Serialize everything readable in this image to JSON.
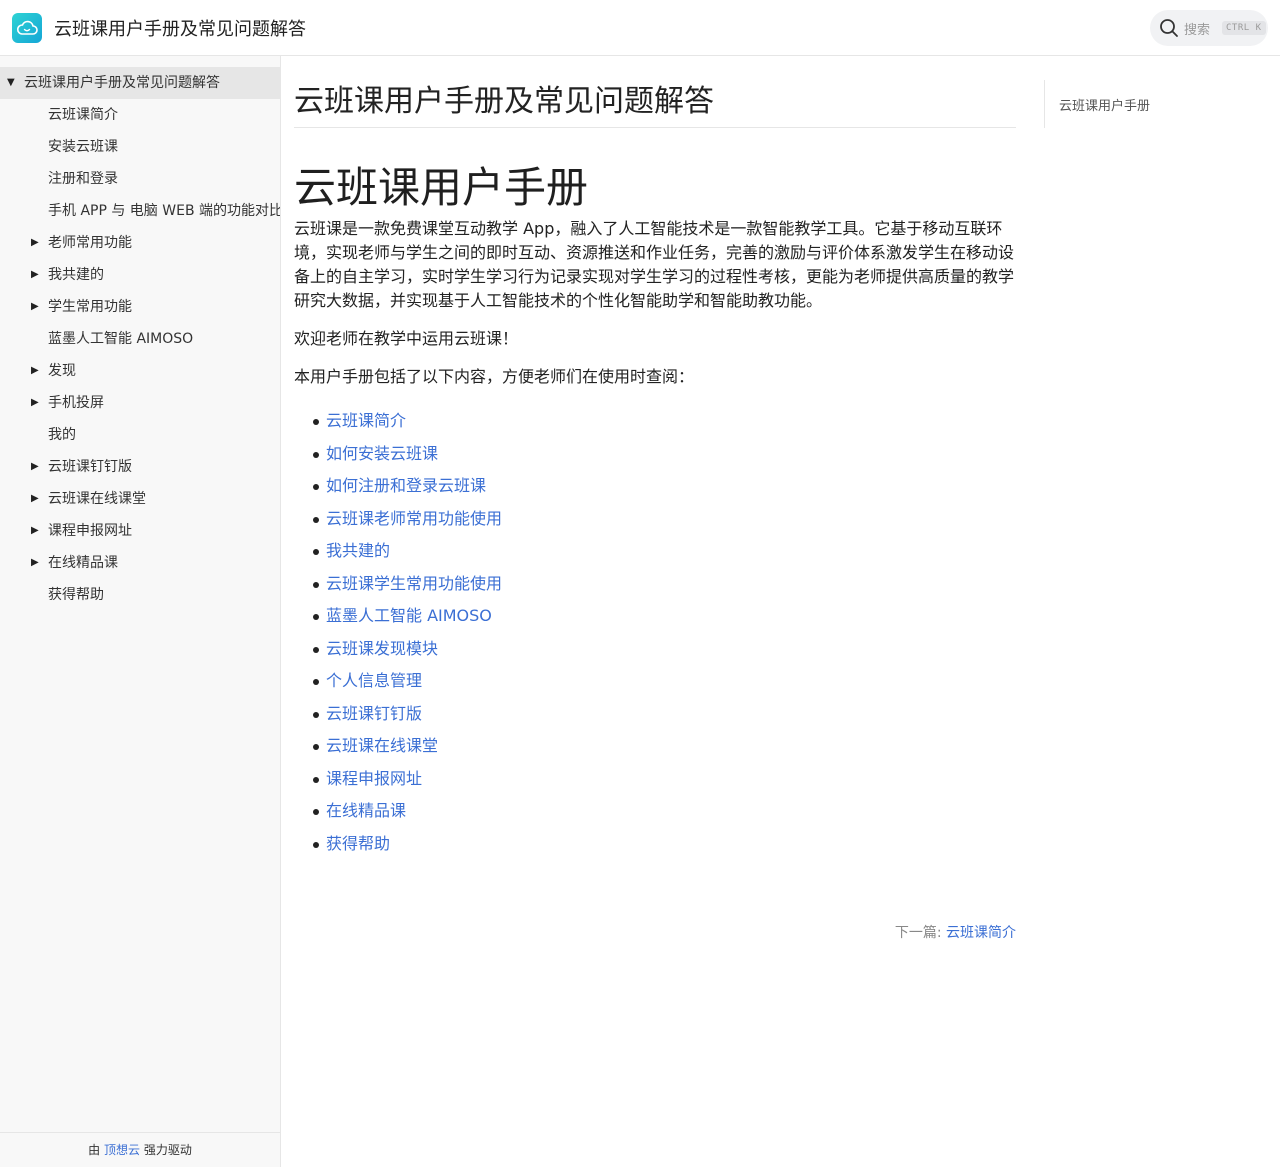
{
  "header": {
    "logo_icon": "cloud-icon",
    "title": "云班课用户手册及常见问题解答",
    "search": {
      "placeholder": "搜索",
      "shortcut": "CTRL K",
      "icon": "search-icon"
    }
  },
  "sidebar": {
    "items": [
      {
        "label": "云班课用户手册及常见问题解答",
        "expandable": true,
        "expanded": true,
        "active": true
      },
      {
        "label": "云班课简介",
        "expandable": false
      },
      {
        "label": "安装云班课",
        "expandable": false
      },
      {
        "label": "注册和登录",
        "expandable": false
      },
      {
        "label": "手机 APP 与 电脑 WEB 端的功能对比",
        "expandable": false
      },
      {
        "label": "老师常用功能",
        "expandable": true
      },
      {
        "label": "我共建的",
        "expandable": true
      },
      {
        "label": "学生常用功能",
        "expandable": true
      },
      {
        "label": "蓝墨人工智能 AIMOSO",
        "expandable": false
      },
      {
        "label": "发现",
        "expandable": true
      },
      {
        "label": "手机投屏",
        "expandable": true
      },
      {
        "label": "我的",
        "expandable": false
      },
      {
        "label": "云班课钉钉版",
        "expandable": true
      },
      {
        "label": "云班课在线课堂",
        "expandable": true
      },
      {
        "label": "课程申报网址",
        "expandable": true
      },
      {
        "label": "在线精品课",
        "expandable": true
      },
      {
        "label": "获得帮助",
        "expandable": false
      }
    ],
    "footer": {
      "prefix": "由",
      "brand": "顶想云",
      "suffix": "强力驱动"
    }
  },
  "main": {
    "page_heading": "云班课用户手册及常见问题解答",
    "h1": "云班课用户手册",
    "paragraphs": [
      "云班课是一款免费课堂互动教学 App，融入了人工智能技术是一款智能教学工具。它基于移动互联环境，实现老师与学生之间的即时互动、资源推送和作业任务，完善的激励与评价体系激发学生在移动设备上的自主学习，实时学生学习行为记录实现对学生学习的过程性考核，更能为老师提供高质量的教学研究大数据，并实现基于人工智能技术的个性化智能助学和智能助教功能。",
      "欢迎老师在教学中运用云班课！",
      "本用户手册包括了以下内容，方便老师们在使用时查阅："
    ],
    "toc_links": [
      "云班课简介",
      "如何安装云班课",
      "如何注册和登录云班课",
      "云班课老师常用功能使用",
      "我共建的",
      "云班课学生常用功能使用",
      "蓝墨人工智能 AIMOSO",
      "云班课发现模块",
      "个人信息管理",
      "云班课钉钉版",
      "云班课在线课堂",
      "课程申报网址",
      "在线精品课",
      "获得帮助"
    ],
    "next": {
      "prefix": "下一篇:",
      "link": "云班课简介"
    }
  },
  "right_toc": {
    "items": [
      "云班课用户手册"
    ]
  },
  "colors": {
    "link": "#3b6fd4",
    "logo_start": "#2ed3d3",
    "logo_end": "#14a6d6",
    "sidebar_bg": "#f8f8f8",
    "active_bg": "#e6e6e6"
  }
}
